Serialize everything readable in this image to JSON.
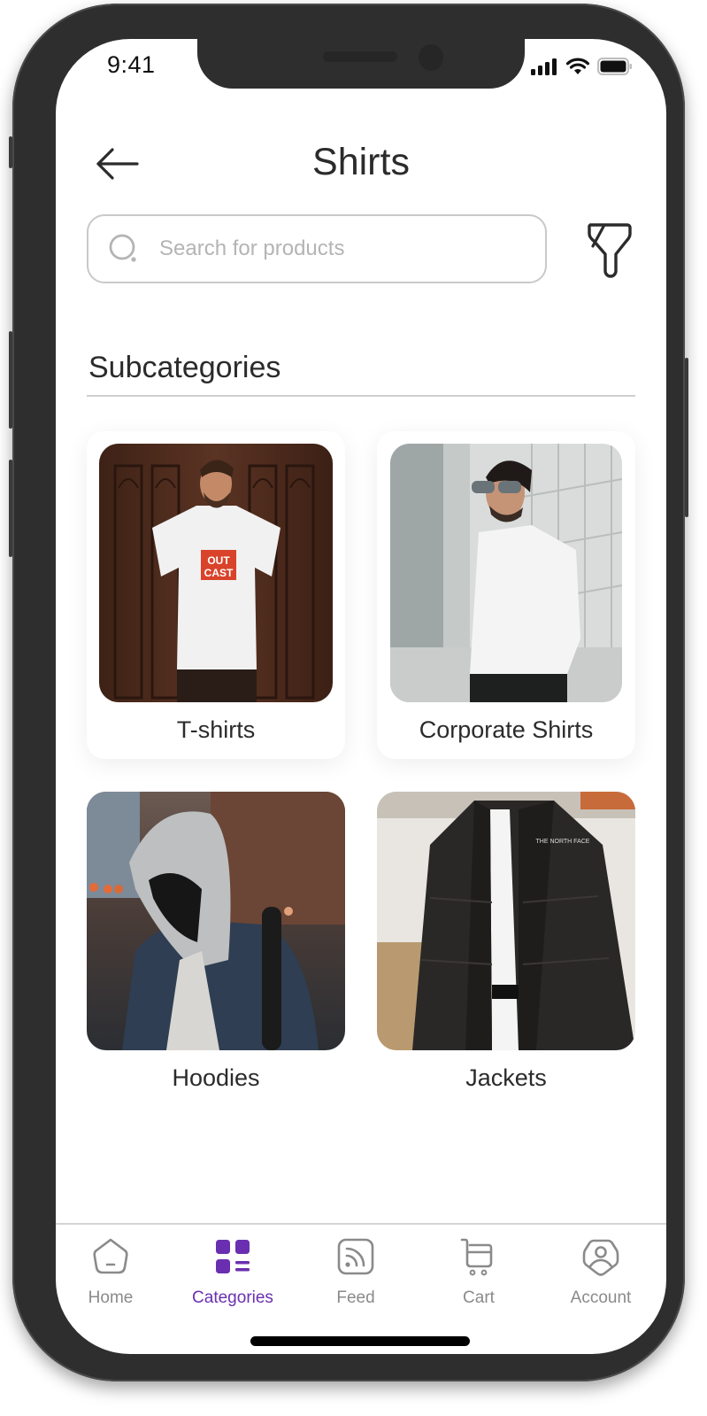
{
  "status_bar": {
    "time": "9:41"
  },
  "header": {
    "title": "Shirts",
    "back_icon": "arrow-left-icon",
    "filter_icon": "filter-icon"
  },
  "search": {
    "placeholder": "Search for products",
    "value": "",
    "icon": "search-icon"
  },
  "section": {
    "title": "Subcategories"
  },
  "subcategories": [
    {
      "label": "T-shirts",
      "image": "man in white graphic t-shirt before wooden door"
    },
    {
      "label": "Corporate Shirts",
      "image": "man in white dress shirt and sunglasses"
    },
    {
      "label": "Hoodies",
      "image": "person in grey hoodie and denim jacket"
    },
    {
      "label": "Jackets",
      "image": "man in black puffer jacket"
    }
  ],
  "nav": {
    "items": [
      {
        "label": "Home",
        "icon": "home-icon",
        "active": false
      },
      {
        "label": "Categories",
        "icon": "categories-icon",
        "active": true
      },
      {
        "label": "Feed",
        "icon": "feed-icon",
        "active": false
      },
      {
        "label": "Cart",
        "icon": "cart-icon",
        "active": false
      },
      {
        "label": "Account",
        "icon": "account-icon",
        "active": false
      }
    ]
  },
  "colors": {
    "accent": "#6a2fb0",
    "text": "#2b2b2b",
    "muted": "#8a8a8a",
    "frame": "#2e2e2e"
  }
}
